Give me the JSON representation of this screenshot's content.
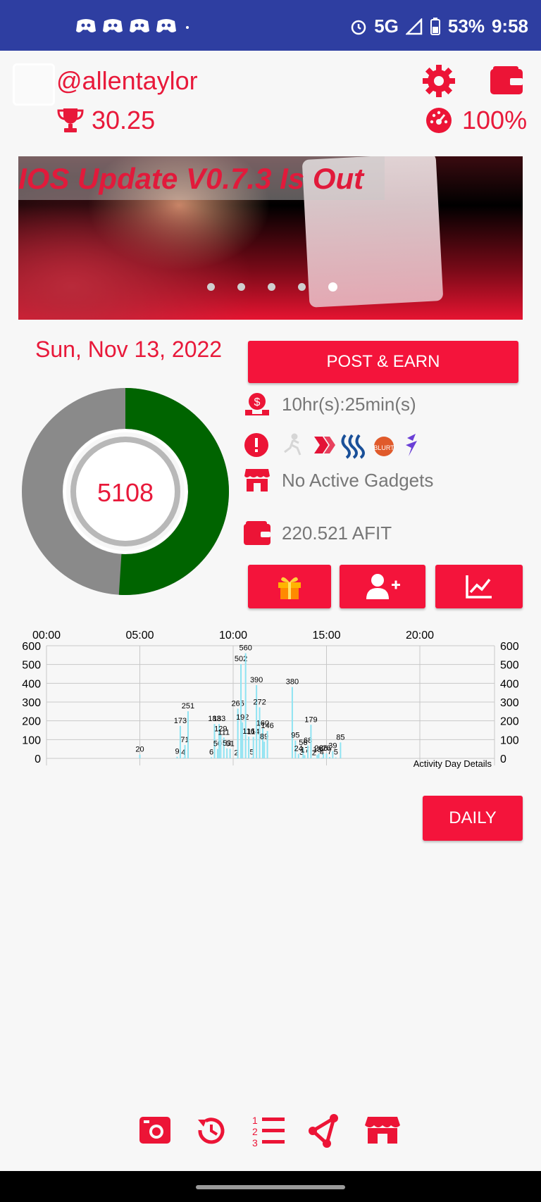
{
  "status_bar": {
    "left_icons": [
      "discord-icon",
      "discord-icon",
      "discord-icon",
      "discord-icon",
      "dot"
    ],
    "network": "5G",
    "battery": "53%",
    "time": "9:58"
  },
  "profile": {
    "username": "@allentaylor",
    "score": "30.25",
    "percent": "100%"
  },
  "banner": {
    "title": "IOS Update V0.7.3 Is Out",
    "slide_count": 5,
    "active_slide": 5
  },
  "activity": {
    "date": "Sun, Nov 13, 2022",
    "post_label": "POST & EARN",
    "time_left": "10hr(s):25min(s)",
    "gadgets": "No Active Gadgets",
    "balance": "220.521 AFIT",
    "steps": "5108",
    "progress_fraction": 0.51
  },
  "colors": {
    "accent": "#f4143b",
    "progress": "#006400",
    "remaining": "#8a8a8a",
    "bar": "#8fe3f2",
    "status_bar": "#2e3ea1"
  },
  "chart_data": {
    "type": "bar",
    "xlabel": "",
    "ylabel": "",
    "ylim": [
      0,
      600
    ],
    "yticks": [
      0,
      100,
      200,
      300,
      400,
      500,
      600
    ],
    "xticks": [
      "00:00",
      "05:00",
      "10:00",
      "15:00",
      "20:00"
    ],
    "legend": "Activity Day Details",
    "interval_minutes": 5,
    "series": [
      {
        "values": [
          [
            60,
            20
          ],
          [
            84,
            9
          ],
          [
            86,
            173
          ],
          [
            88,
            4
          ],
          [
            89,
            71
          ],
          [
            91,
            251
          ],
          [
            106,
            6
          ],
          [
            108,
            183
          ],
          [
            110,
            50
          ],
          [
            111,
            183
          ],
          [
            112,
            129
          ],
          [
            114,
            111
          ],
          [
            116,
            53
          ],
          [
            118,
            51
          ],
          [
            122,
            2
          ],
          [
            123,
            265
          ],
          [
            125,
            502
          ],
          [
            126,
            192
          ],
          [
            128,
            560
          ],
          [
            130,
            116
          ],
          [
            132,
            5
          ],
          [
            133,
            114
          ],
          [
            135,
            390
          ],
          [
            137,
            272
          ],
          [
            139,
            160
          ],
          [
            140,
            89
          ],
          [
            142,
            146
          ],
          [
            158,
            380
          ],
          [
            160,
            95
          ],
          [
            162,
            24
          ],
          [
            164,
            3
          ],
          [
            165,
            56
          ],
          [
            166,
            17
          ],
          [
            168,
            68
          ],
          [
            170,
            179
          ],
          [
            172,
            2
          ],
          [
            174,
            18
          ],
          [
            175,
            26
          ],
          [
            177,
            4
          ],
          [
            178,
            26
          ],
          [
            180,
            26
          ],
          [
            182,
            7
          ],
          [
            184,
            39
          ],
          [
            186,
            5
          ],
          [
            189,
            85
          ]
        ]
      }
    ]
  },
  "footer": {
    "daily_label": "DAILY"
  }
}
